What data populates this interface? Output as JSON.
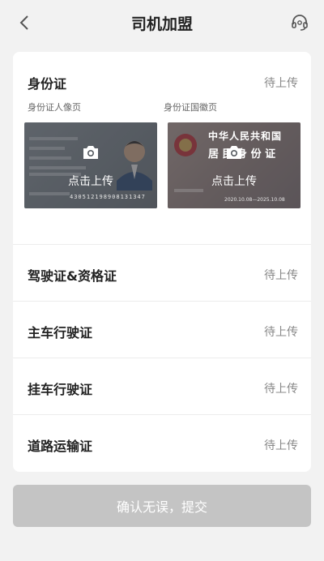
{
  "header": {
    "title": "司机加盟",
    "back_icon": "chevron-left-icon",
    "service_icon": "headset-icon"
  },
  "id_card": {
    "title": "身份证",
    "status": "待上传",
    "front_label": "身份证人像页",
    "back_label": "身份证国徽页",
    "front_upload": "点击上传",
    "back_upload": "点击上传",
    "front_number": "430512198908131347",
    "back_heading_1": "中华人民共和国",
    "back_heading_2": "居 民 身 份 证",
    "back_validity": "2020.10.08—2025.10.08"
  },
  "documents": [
    {
      "label": "驾驶证&资格证",
      "status": "待上传"
    },
    {
      "label": "主车行驶证",
      "status": "待上传"
    },
    {
      "label": "挂车行驶证",
      "status": "待上传"
    },
    {
      "label": "道路运输证",
      "status": "待上传"
    }
  ],
  "submit_label": "确认无误，提交",
  "colors": {
    "background": "#f2f2f2",
    "card": "#ffffff",
    "status_text": "#888888",
    "submit_disabled": "#c4c4c4"
  }
}
